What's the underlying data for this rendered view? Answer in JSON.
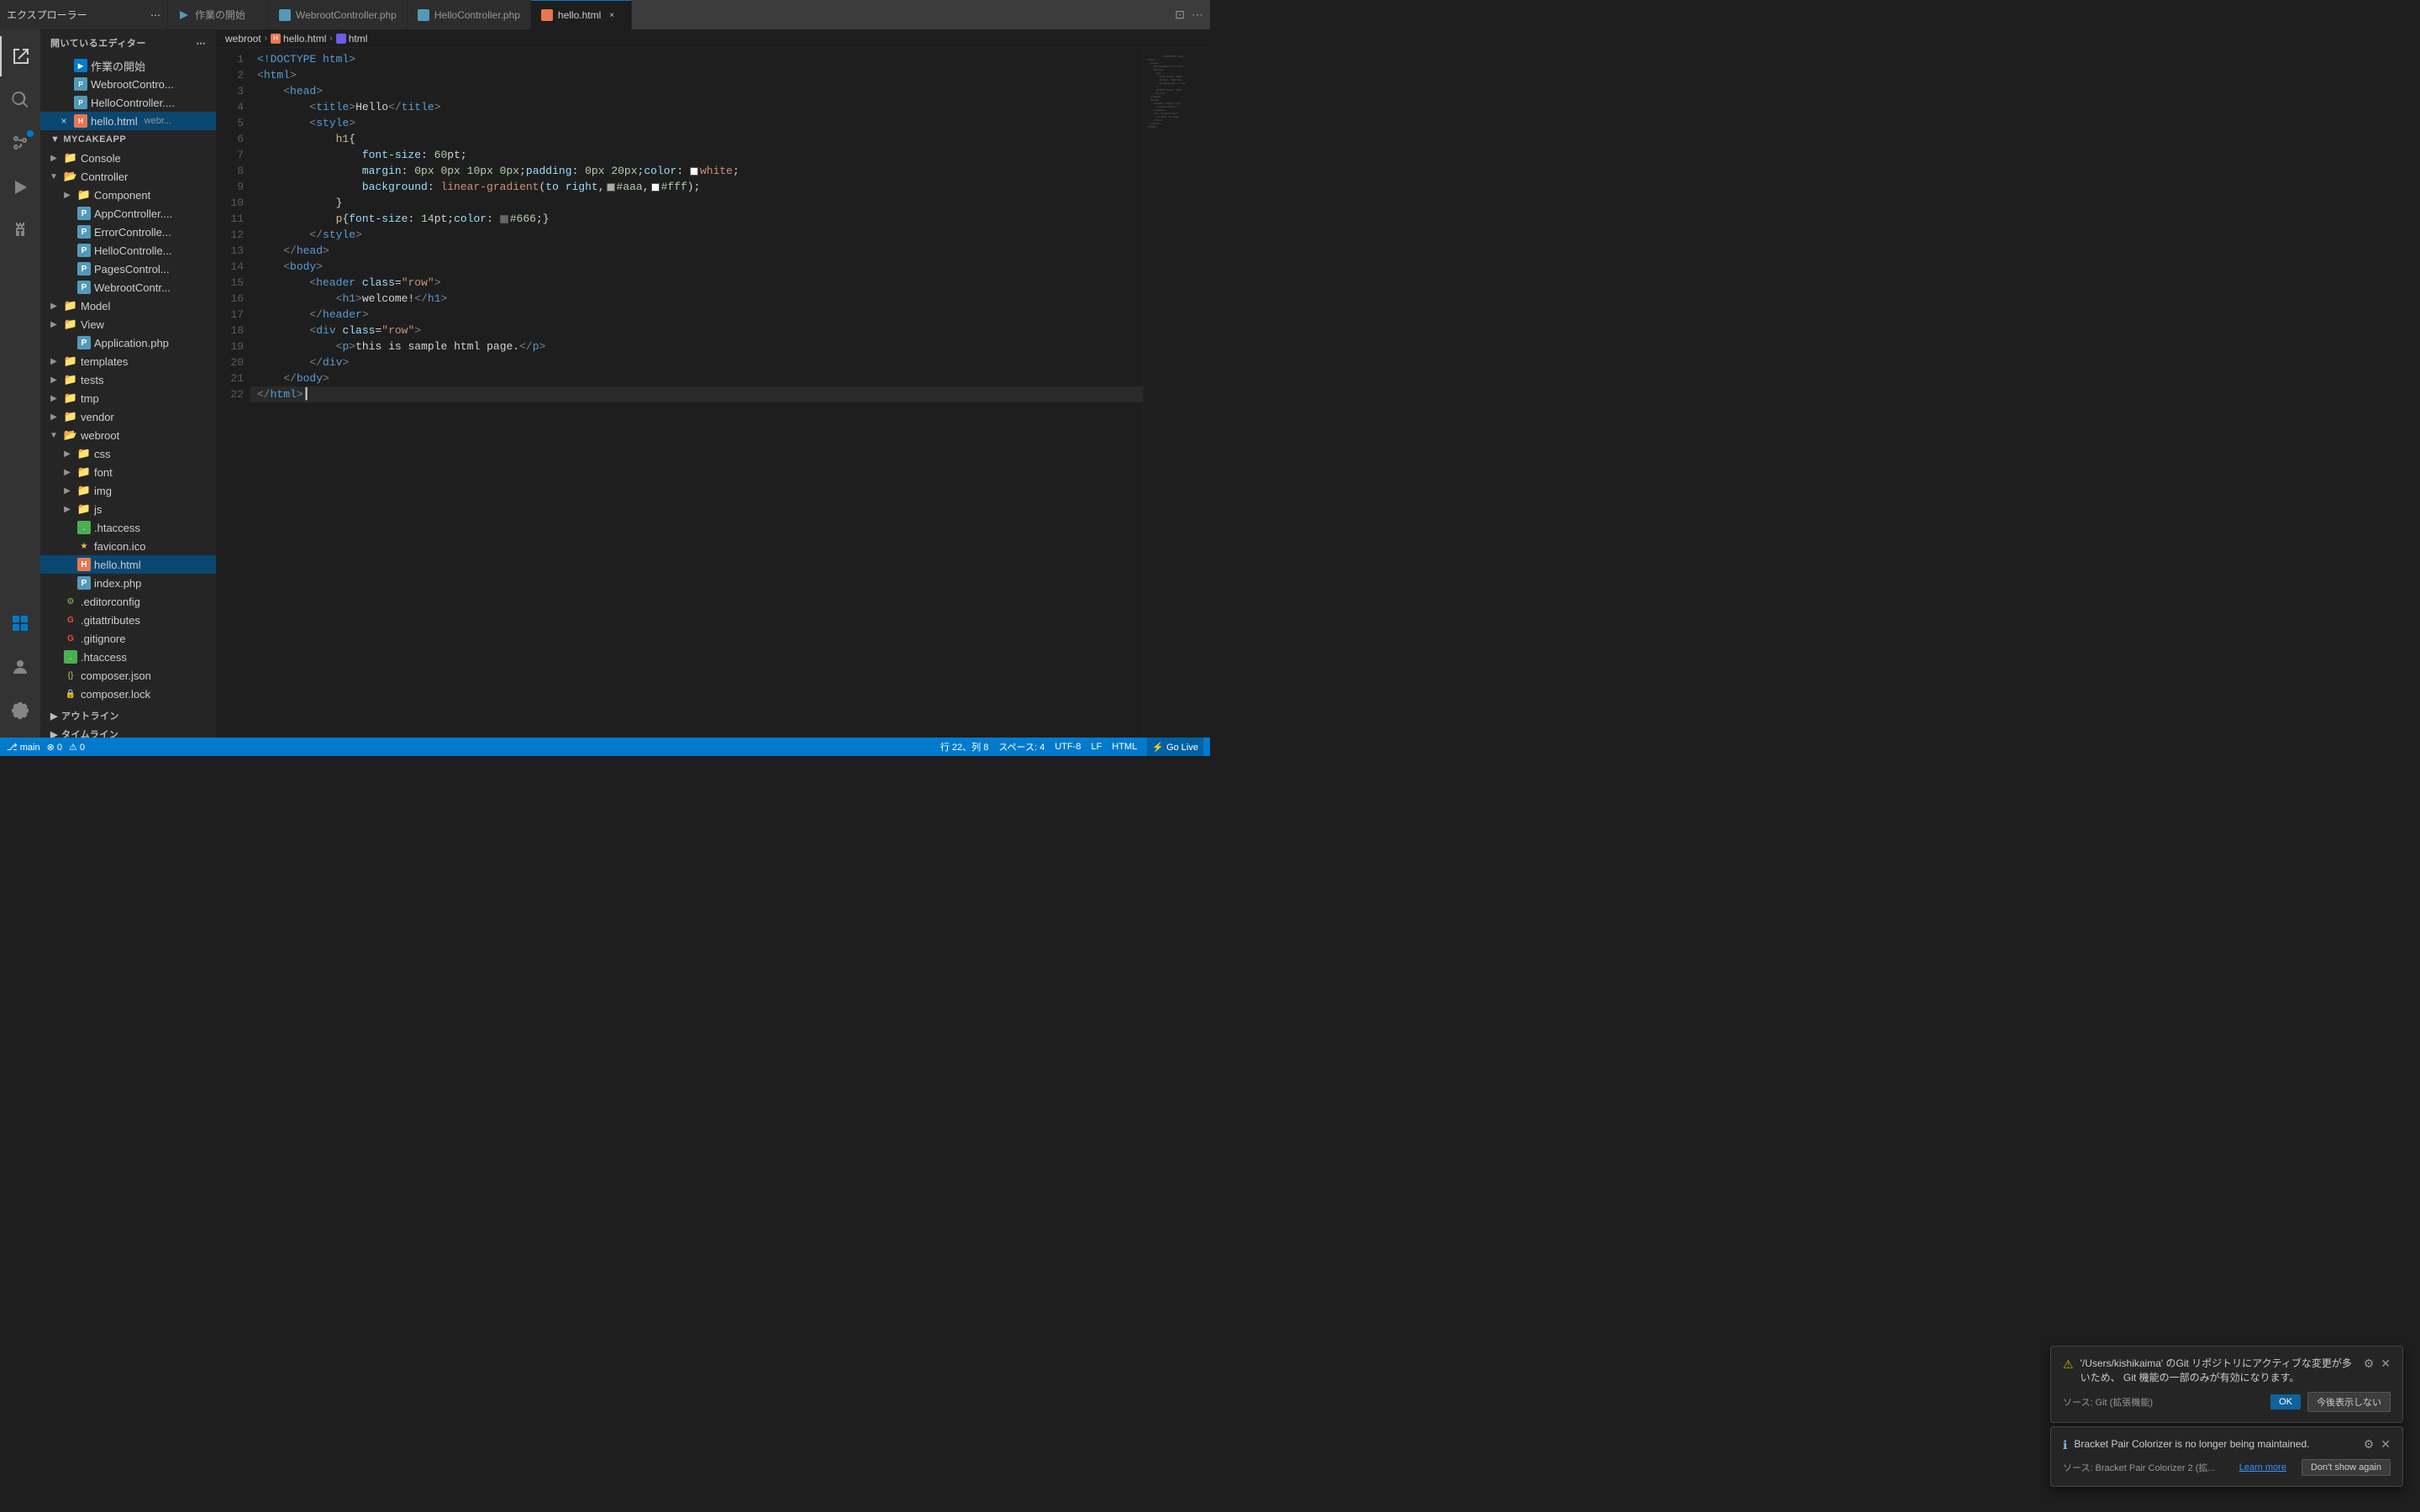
{
  "titlebar": {
    "explorer_label": "エクスプローラー",
    "more_icon": "⋯",
    "tabs": [
      {
        "id": "getting-started",
        "label": "作業の開始",
        "icon_color": "getting-started",
        "active": false,
        "closable": false
      },
      {
        "id": "webroot-controller",
        "label": "WebrootController.php",
        "icon_color": "blue",
        "active": false,
        "closable": false
      },
      {
        "id": "hello-controller",
        "label": "HelloController.php",
        "icon_color": "blue",
        "active": false,
        "closable": false
      },
      {
        "id": "hello-html",
        "label": "hello.html",
        "icon_color": "red",
        "active": true,
        "closable": true
      }
    ],
    "layout_icon": "⊡",
    "more_icon2": "⋯"
  },
  "breadcrumb": {
    "parts": [
      "webroot",
      ">",
      "hello.html",
      ">",
      "html"
    ]
  },
  "sidebar": {
    "header": "開いているエディター",
    "open_editors": [
      {
        "label": "作業の開始",
        "icon": "gs",
        "icon_color": "blue-dark"
      },
      {
        "label": "WebrootContro...",
        "icon": "php",
        "icon_color": "blue"
      },
      {
        "label": "HelloController....",
        "icon": "php",
        "icon_color": "blue"
      },
      {
        "label": "hello.html",
        "icon": "html",
        "suffix": "webr...",
        "selected": true,
        "has_close": true
      }
    ],
    "project_name": "MYCAKEAPP",
    "tree": [
      {
        "level": 0,
        "label": "Console",
        "type": "folder",
        "open": false,
        "folder_color": "blue"
      },
      {
        "level": 0,
        "label": "Controller",
        "type": "folder",
        "open": true,
        "folder_color": "blue"
      },
      {
        "level": 1,
        "label": "Component",
        "type": "folder",
        "open": false,
        "folder_color": "blue"
      },
      {
        "level": 1,
        "label": "AppController....",
        "type": "php",
        "icon_color": "blue"
      },
      {
        "level": 1,
        "label": "ErrorControlle...",
        "type": "php",
        "icon_color": "blue"
      },
      {
        "level": 1,
        "label": "HelloControlle...",
        "type": "php",
        "icon_color": "blue"
      },
      {
        "level": 1,
        "label": "PagesControl...",
        "type": "php",
        "icon_color": "blue"
      },
      {
        "level": 1,
        "label": "WebrootContr...",
        "type": "php",
        "icon_color": "blue"
      },
      {
        "level": 0,
        "label": "Model",
        "type": "folder",
        "open": false,
        "folder_color": "blue"
      },
      {
        "level": 0,
        "label": "View",
        "type": "folder",
        "open": false,
        "folder_color": "blue"
      },
      {
        "level": 1,
        "label": "Application.php",
        "type": "php",
        "icon_color": "blue"
      },
      {
        "level": 0,
        "label": "templates",
        "type": "folder",
        "open": false,
        "folder_color": "orange"
      },
      {
        "level": 0,
        "label": "tests",
        "type": "folder",
        "open": false,
        "folder_color": "orange"
      },
      {
        "level": 0,
        "label": "tmp",
        "type": "folder",
        "open": false,
        "folder_color": "orange"
      },
      {
        "level": 0,
        "label": "vendor",
        "type": "folder",
        "open": false,
        "folder_color": "orange"
      },
      {
        "level": 0,
        "label": "webroot",
        "type": "folder",
        "open": true,
        "folder_color": "orange"
      },
      {
        "level": 1,
        "label": "css",
        "type": "folder",
        "open": false,
        "folder_color": "blue"
      },
      {
        "level": 1,
        "label": "font",
        "type": "folder",
        "open": false,
        "folder_color": "orange"
      },
      {
        "level": 1,
        "label": "img",
        "type": "folder",
        "open": false,
        "folder_color": "orange"
      },
      {
        "level": 1,
        "label": "js",
        "type": "folder",
        "open": false,
        "folder_color": "orange"
      },
      {
        "level": 1,
        "label": ".htaccess",
        "type": "htaccess"
      },
      {
        "level": 1,
        "label": "favicon.ico",
        "type": "star"
      },
      {
        "level": 1,
        "label": "hello.html",
        "type": "html",
        "selected": true
      },
      {
        "level": 1,
        "label": "index.php",
        "type": "php",
        "icon_color": "blue"
      },
      {
        "level": 0,
        "label": ".editorconfig",
        "type": "editorconfig"
      },
      {
        "level": 0,
        "label": ".gitattributes",
        "type": "git"
      },
      {
        "level": 0,
        "label": ".gitignore",
        "type": "git"
      },
      {
        "level": 0,
        "label": ".htaccess",
        "type": "htaccess"
      },
      {
        "level": 0,
        "label": "composer.json",
        "type": "json"
      },
      {
        "level": 0,
        "label": "composer.lock",
        "type": "lock"
      }
    ],
    "outline_label": "アウトライン",
    "timeline_label": "タイムライン"
  },
  "code": {
    "lines": [
      {
        "num": 1,
        "content": "<!DOCTYPE html>",
        "type": "doctype"
      },
      {
        "num": 2,
        "content": "<html>",
        "type": "tag"
      },
      {
        "num": 3,
        "content": "    <head>",
        "type": "tag"
      },
      {
        "num": 4,
        "content": "        <title>Hello</title>",
        "type": "tag"
      },
      {
        "num": 5,
        "content": "        <style>",
        "type": "tag"
      },
      {
        "num": 6,
        "content": "            h1{",
        "type": "selector"
      },
      {
        "num": 7,
        "content": "                font-size: 60pt;",
        "type": "css"
      },
      {
        "num": 8,
        "content": "                margin: 0px 0px 10px 0px;padding: 0px 20px;color: ■white;",
        "type": "css_color"
      },
      {
        "num": 9,
        "content": "                background: linear-gradient(to right,■#aaa,■#fff);",
        "type": "css_gradient"
      },
      {
        "num": 10,
        "content": "            }",
        "type": "text"
      },
      {
        "num": 11,
        "content": "            p{font-size: 14pt;color: ■#666;}",
        "type": "css_inline"
      },
      {
        "num": 12,
        "content": "        </style>",
        "type": "tag"
      },
      {
        "num": 13,
        "content": "    </head>",
        "type": "tag"
      },
      {
        "num": 14,
        "content": "    <body>",
        "type": "tag"
      },
      {
        "num": 15,
        "content": "        <header class=\"row\">",
        "type": "tag"
      },
      {
        "num": 16,
        "content": "            <h1>welcome!</h1>",
        "type": "tag"
      },
      {
        "num": 17,
        "content": "        </header>",
        "type": "tag"
      },
      {
        "num": 18,
        "content": "        <div class=\"row\">",
        "type": "tag"
      },
      {
        "num": 19,
        "content": "            <p>this is sample html page.</p>",
        "type": "tag"
      },
      {
        "num": 20,
        "content": "        </div>",
        "type": "tag"
      },
      {
        "num": 21,
        "content": "    </body>",
        "type": "tag"
      },
      {
        "num": 22,
        "content": "</html>",
        "type": "tag"
      }
    ]
  },
  "notifications": {
    "git_notif": {
      "icon": "⚠",
      "message": "'/Users/kishikaima' のGit リポジトリにアクティブな変更が多\nいため、 Git 機能の一部のみが有効になります。",
      "source": "ソース: Git (拡張機能)",
      "ok_label": "OK",
      "dismiss_label": "今後表示しない"
    },
    "bracket_notif": {
      "icon": "ℹ",
      "message": "Bracket Pair Colorizer is no longer being maintained.",
      "source": "ソース: Bracket Pair Colorizer 2 (拡...",
      "learn_more_label": "Learn more",
      "dont_show_label": "Don't show again"
    }
  },
  "statusbar": {
    "git_branch": "⎇  main",
    "errors": "⊗ 0",
    "warnings": "⚠ 0",
    "line_col": "行 22、列 8",
    "spaces": "スペース: 4",
    "encoding": "UTF-8",
    "line_ending": "LF",
    "language": "HTML",
    "go_live": "⚡ Go Live"
  },
  "colors": {
    "accent": "#007acc",
    "sidebar_bg": "#252526",
    "editor_bg": "#1e1e1e",
    "titlebar_bg": "#3c3c3c",
    "tab_active_bg": "#1e1e1e",
    "tab_inactive_bg": "#2d2d2d",
    "statusbar_bg": "#007acc",
    "notification_bg": "#252526"
  }
}
